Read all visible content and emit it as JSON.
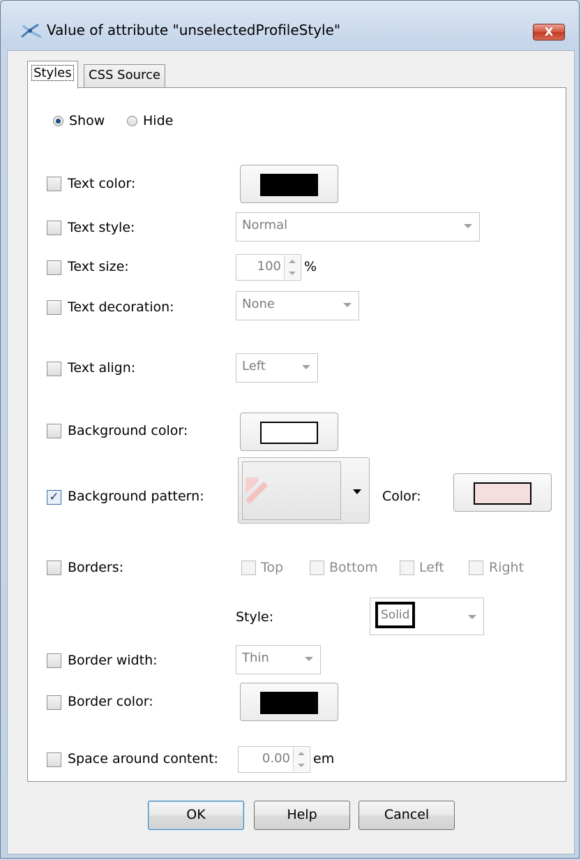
{
  "window": {
    "title": "Value of attribute \"unselectedProfileStyle\"",
    "close_label": "X"
  },
  "tabs": [
    {
      "label": "Styles"
    },
    {
      "label": "CSS Source"
    }
  ],
  "visibility": {
    "show_label": "Show",
    "hide_label": "Hide",
    "selected": "Show"
  },
  "rows": {
    "text_color": {
      "label": "Text color:",
      "checked": false,
      "color": "#000000"
    },
    "text_style": {
      "label": "Text style:",
      "checked": false,
      "value": "Normal"
    },
    "text_size": {
      "label": "Text size:",
      "checked": false,
      "value": "100",
      "unit": "%"
    },
    "text_decoration": {
      "label": "Text decoration:",
      "checked": false,
      "value": "None"
    },
    "text_align": {
      "label": "Text align:",
      "checked": false,
      "value": "Left"
    },
    "background_color": {
      "label": "Background color:",
      "checked": false,
      "color": "#ffffff"
    },
    "background_pattern": {
      "label": "Background pattern:",
      "checked": true,
      "color_label": "Color:",
      "color": "#f5dede"
    },
    "borders": {
      "label": "Borders:",
      "checked": false,
      "options": [
        "Top",
        "Bottom",
        "Left",
        "Right"
      ],
      "style_label": "Style:",
      "style_value": "Solid"
    },
    "border_width": {
      "label": "Border width:",
      "checked": false,
      "value": "Thin"
    },
    "border_color": {
      "label": "Border color:",
      "checked": false,
      "color": "#000000"
    },
    "space_around": {
      "label": "Space around content:",
      "checked": false,
      "value": "0.00",
      "unit": "em"
    }
  },
  "buttons": {
    "ok": "OK",
    "help": "Help",
    "cancel": "Cancel"
  }
}
